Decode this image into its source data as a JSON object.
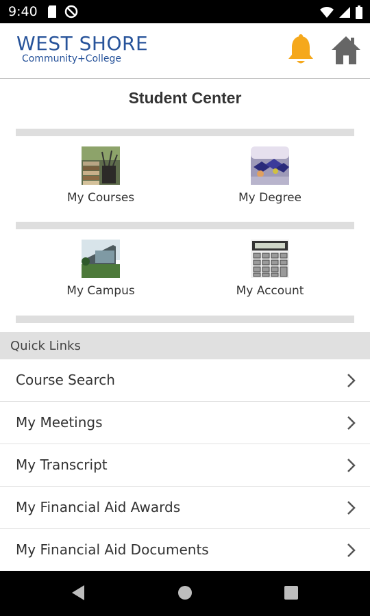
{
  "status_bar": {
    "time": "9:40"
  },
  "header": {
    "logo_line1": "WEST SHORE",
    "logo_line2": "Community+College",
    "brand_color": "#27539a",
    "bell_color": "#f5a81c"
  },
  "page": {
    "title": "Student Center"
  },
  "tiles": [
    {
      "label": "My Courses",
      "icon": "books-image"
    },
    {
      "label": "My Degree",
      "icon": "graduation-image"
    },
    {
      "label": "My Campus",
      "icon": "campus-building-image"
    },
    {
      "label": "My Account",
      "icon": "calculator-image"
    }
  ],
  "quick_links": {
    "header": "Quick Links",
    "items": [
      {
        "label": "Course Search"
      },
      {
        "label": "My Meetings"
      },
      {
        "label": "My Transcript"
      },
      {
        "label": "My Financial Aid Awards"
      },
      {
        "label": "My Financial Aid Documents"
      }
    ]
  }
}
